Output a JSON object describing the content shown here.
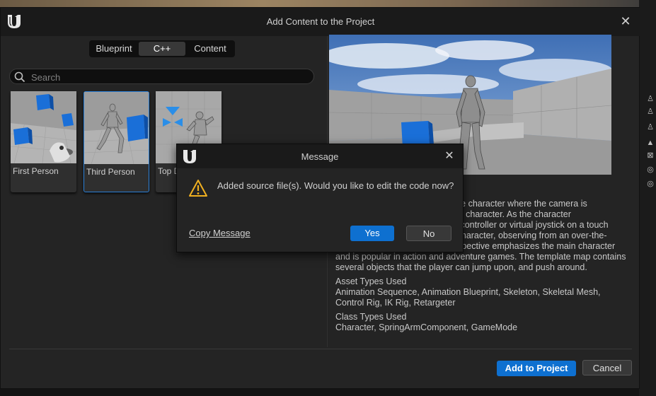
{
  "window": {
    "title": "Add Content to the Project"
  },
  "tabs": [
    {
      "label": "Blueprint"
    },
    {
      "label": "C++",
      "selected": true
    },
    {
      "label": "Content"
    }
  ],
  "search": {
    "placeholder": "Search",
    "value": ""
  },
  "templates": [
    {
      "label": "First Person"
    },
    {
      "label": "Third Person",
      "selected": true
    },
    {
      "label": "Top Down"
    }
  ],
  "description": {
    "paragraph": [
      "This template features a playable character where the camera is",
      "positioned behind and above the character. As the character",
      "moves using mouse, keyboard, controller or virtual joystick on a touch",
      "device, the camera follows the character, observing from an over-the-",
      "shoulder point of view. This perspective emphasizes the main character",
      "and is popular in action and adventure games. The template map contains",
      "several objects that the player can jump upon, and push around."
    ],
    "asset_types_heading": "Asset Types Used",
    "asset_types": [
      "Animation Sequence, Animation Blueprint, Skeleton, Skeletal Mesh,",
      "Control Rig, IK Rig, Retargeter"
    ],
    "class_types_heading": "Class Types Used",
    "class_types": "Character, SpringArmComponent, GameMode"
  },
  "footer": {
    "add_label": "Add to Project",
    "cancel_label": "Cancel"
  },
  "dialog": {
    "title": "Message",
    "message": "Added source file(s). Would you like to edit the code now?",
    "copy_label": "Copy Message",
    "yes_label": "Yes",
    "no_label": "No"
  },
  "colors": {
    "accent": "#0e70d0",
    "selection_border": "#2a7fd6",
    "warning": "#f0b020"
  }
}
